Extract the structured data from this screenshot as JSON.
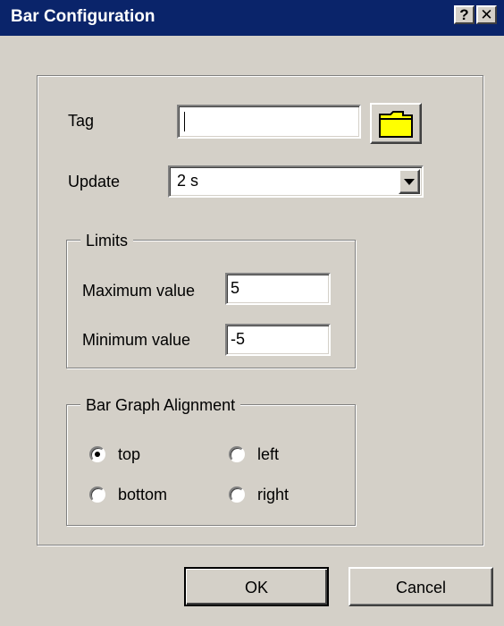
{
  "window": {
    "title": "Bar Configuration",
    "help_button": "?",
    "close_button": "✕"
  },
  "form": {
    "tag_label": "Tag",
    "tag_value": "",
    "update_label": "Update",
    "update_value": "2 s"
  },
  "limits": {
    "group_label": "Limits",
    "max_label": "Maximum value",
    "max_value": "5",
    "min_label": "Minimum value",
    "min_value": "-5"
  },
  "alignment": {
    "group_label": "Bar Graph Alignment",
    "options": [
      {
        "label": "top",
        "selected": true
      },
      {
        "label": "left",
        "selected": false
      },
      {
        "label": "bottom",
        "selected": false
      },
      {
        "label": "right",
        "selected": false
      }
    ]
  },
  "buttons": {
    "ok": "OK",
    "cancel": "Cancel"
  }
}
